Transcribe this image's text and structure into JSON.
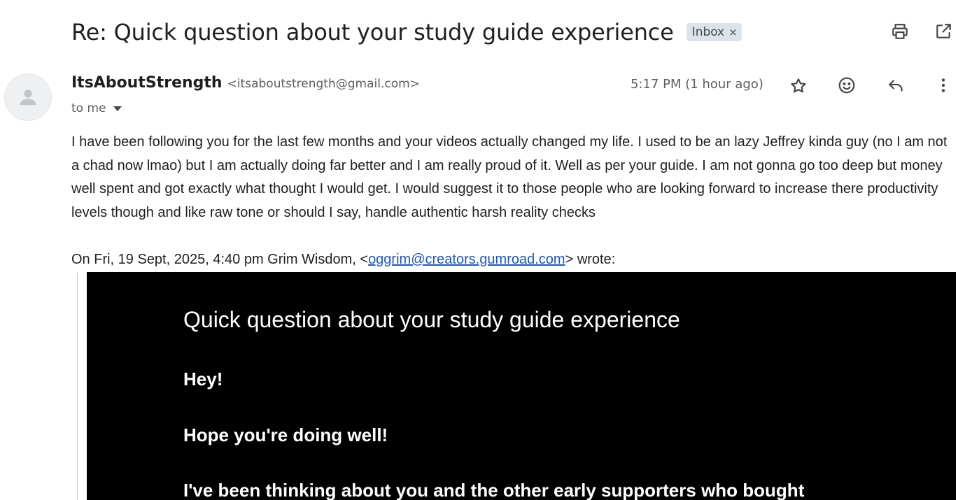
{
  "email": {
    "subject": "Re: Quick question about your study guide experience",
    "label": "Inbox",
    "label_remove": "×",
    "sender": {
      "name": "ItsAboutStrength",
      "email": "<itsaboutstrength@gmail.com>"
    },
    "recipient": "to me",
    "timestamp": "5:17 PM (1 hour ago)",
    "body": "I have been following you for the last few months and your videos actually changed my life. I used to be an lazy Jeffrey kinda guy (no I am not a chad now lmao) but I am actually doing far better and I am really proud of it. Well as per your guide. I am not gonna go too deep but money well spent and got exactly what thought I would get. I would suggest it to those people who are looking forward to increase there productivity levels though and like raw tone or should I say, handle authentic harsh reality checks",
    "quote": {
      "header_prefix": "On Fri, 19 Sept, 2025, 4:40 pm Grim Wisdom, <",
      "header_email": "oggrim@creators.gumroad.com",
      "header_suffix": "> wrote:",
      "title": "Quick question about your study guide experience",
      "lines": [
        "Hey!",
        "Hope you're doing well!",
        "I've been thinking about you and the other early supporters who bought"
      ]
    }
  },
  "icons": {
    "print": "printer-icon",
    "open_new_window": "open-in-new-window-icon",
    "star": "star-icon",
    "emoji": "emoji-reaction-icon",
    "reply": "reply-icon",
    "more": "more-vertical-icon",
    "avatar": "default-avatar-icon"
  },
  "colors": {
    "label_chip_bg": "#dde3ea",
    "link": "#1a57c8",
    "quoted_bg": "#000000",
    "quoted_text": "#ffffff",
    "secondary_text": "#5e5e5e"
  }
}
